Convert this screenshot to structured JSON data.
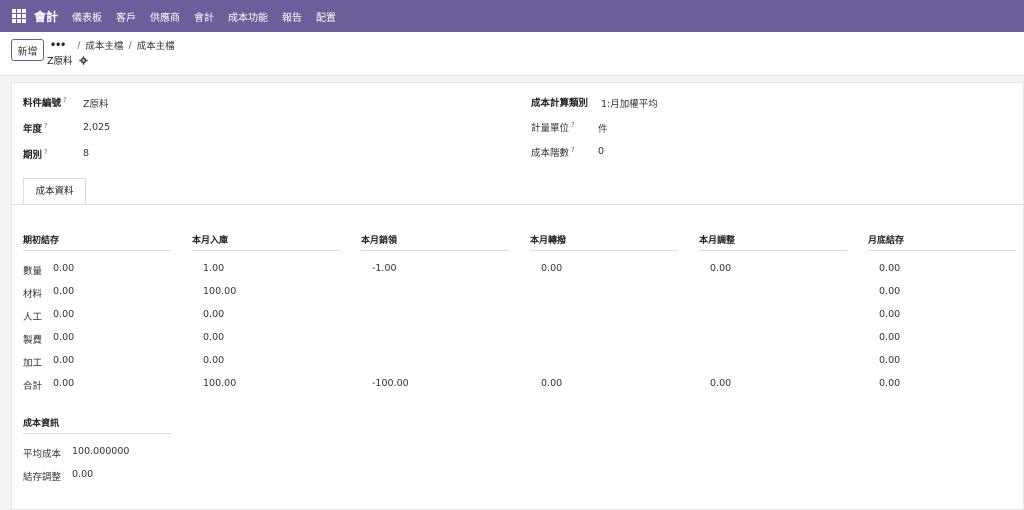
{
  "navbar": {
    "app_name": "會計",
    "menu": [
      "儀表板",
      "客戶",
      "供應商",
      "會計",
      "成本功能",
      "報告",
      "配置"
    ]
  },
  "control": {
    "new_label": "新增",
    "breadcrumbs": [
      "成本主檔",
      "成本主檔"
    ],
    "record_title": "Z原料"
  },
  "fields": {
    "item_no": {
      "label": "料件編號",
      "value": "Z原料"
    },
    "year": {
      "label": "年度",
      "value": "2,025"
    },
    "period": {
      "label": "期別",
      "value": "8"
    },
    "cost_calc_type": {
      "label": "成本計算類別",
      "value": "1:月加權平均"
    },
    "uom": {
      "label": "計量單位",
      "value": "件"
    },
    "cost_level": {
      "label": "成本階數",
      "value": "0"
    },
    "help_mark": "?"
  },
  "tabs": [
    {
      "label": "成本資料"
    }
  ],
  "cost_table": {
    "columns": [
      "期初結存",
      "本月入庫",
      "本月銷領",
      "本月轉撥",
      "本月調整",
      "月底結存"
    ],
    "row_labels": [
      "數量",
      "材料",
      "人工",
      "製費",
      "加工",
      "合計"
    ],
    "cells": [
      [
        "0.00",
        "1.00",
        "-1.00",
        "0.00",
        "0.00",
        "0.00"
      ],
      [
        "0.00",
        "100.00",
        "",
        "",
        "",
        "0.00"
      ],
      [
        "0.00",
        "0.00",
        "",
        "",
        "",
        "0.00"
      ],
      [
        "0.00",
        "0.00",
        "",
        "",
        "",
        "0.00"
      ],
      [
        "0.00",
        "0.00",
        "",
        "",
        "",
        "0.00"
      ],
      [
        "0.00",
        "100.00",
        "-100.00",
        "0.00",
        "0.00",
        "0.00"
      ]
    ]
  },
  "cost_info": {
    "title": "成本資訊",
    "avg_cost": {
      "label": "平均成本",
      "value": "100.000000"
    },
    "balance_adj": {
      "label": "結存調整",
      "value": "0.00"
    }
  }
}
